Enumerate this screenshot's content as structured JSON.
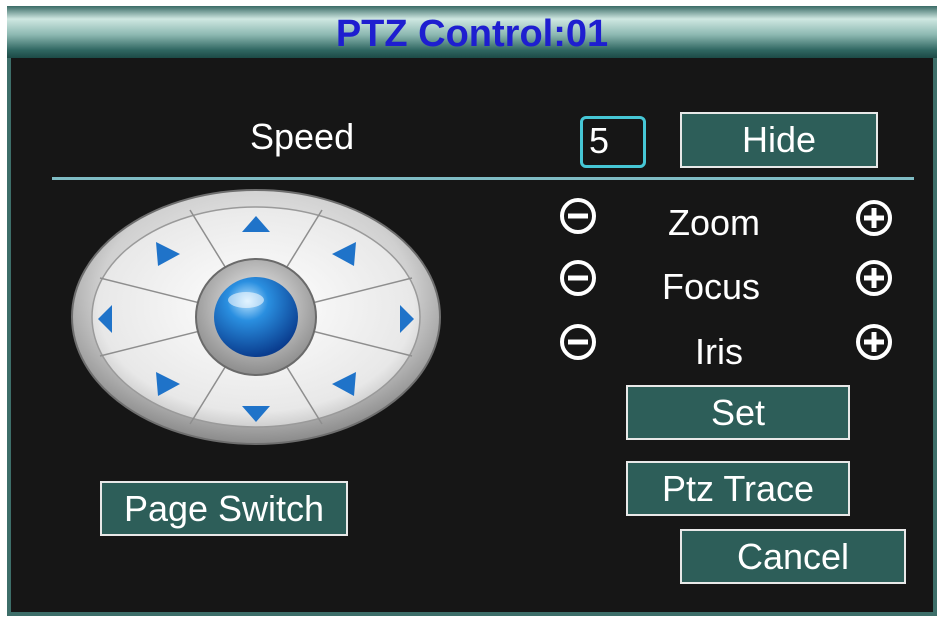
{
  "window": {
    "title": "PTZ Control:01"
  },
  "speed": {
    "label": "Speed",
    "value": "5",
    "hide_label": "Hide"
  },
  "lens_controls": [
    {
      "label": "Zoom",
      "minus_icon": "minus-circle-icon",
      "plus_icon": "plus-circle-icon"
    },
    {
      "label": "Focus",
      "minus_icon": "minus-circle-icon",
      "plus_icon": "plus-circle-icon"
    },
    {
      "label": "Iris",
      "minus_icon": "minus-circle-icon",
      "plus_icon": "plus-circle-icon"
    }
  ],
  "buttons": {
    "set": "Set",
    "ptz_trace": "Ptz Trace",
    "cancel": "Cancel",
    "page_switch": "Page Switch"
  },
  "colors": {
    "title_text": "#1e1ed0",
    "button_bg": "#2d5e59",
    "panel_bg": "#161616",
    "accent": "#46c7d6"
  }
}
